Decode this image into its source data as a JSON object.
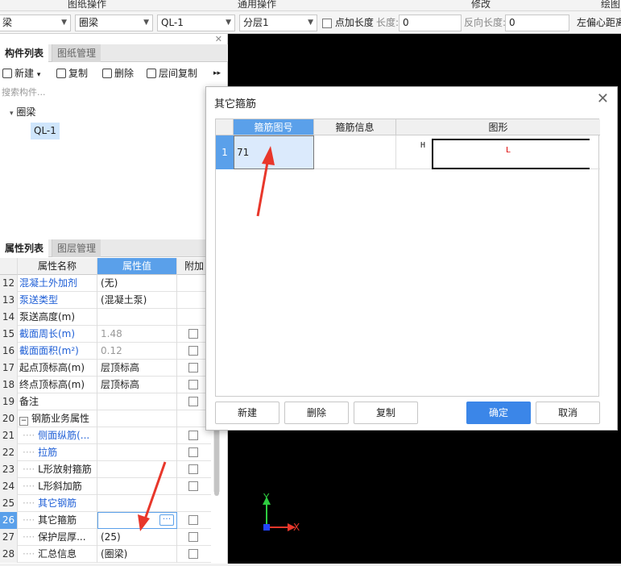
{
  "toolbar": {
    "items": [
      "图纸操作",
      "通用操作",
      "修改",
      "绘图"
    ]
  },
  "filters": {
    "combo1": "梁",
    "combo2": "圈梁",
    "combo3": "QL-1",
    "combo4": "分层1",
    "check_label": "点加长度",
    "length_label": "长度:",
    "length_value": "0",
    "reverse_label": "反向长度:",
    "reverse_value": "0",
    "offset_label": "左偏心距离"
  },
  "component_panel": {
    "tabs": [
      "构件列表",
      "图纸管理"
    ],
    "buttons": [
      "新建",
      "复制",
      "删除",
      "层间复制"
    ],
    "search_placeholder": "搜索构件...",
    "tree_parent": "圈梁",
    "tree_child": "QL-1"
  },
  "property_panel": {
    "tabs": [
      "属性列表",
      "图层管理"
    ],
    "headers": [
      "属性名称",
      "属性值",
      "附加"
    ],
    "rows": [
      {
        "num": "12",
        "name": "混凝土外加剂",
        "value": "(无)"
      },
      {
        "num": "13",
        "name": "泵送类型",
        "value": "(混凝土泵)"
      },
      {
        "num": "14",
        "name": "泵送高度(m)",
        "value": ""
      },
      {
        "num": "15",
        "name": "截面周长(m)",
        "value": "1.48"
      },
      {
        "num": "16",
        "name": "截面面积(m²)",
        "value": "0.12"
      },
      {
        "num": "17",
        "name": "起点顶标高(m)",
        "value": "层顶标高"
      },
      {
        "num": "18",
        "name": "终点顶标高(m)",
        "value": "层顶标高"
      },
      {
        "num": "19",
        "name": "备注",
        "value": ""
      },
      {
        "num": "20",
        "name": "钢筋业务属性",
        "value": ""
      },
      {
        "num": "21",
        "name": "侧面纵筋(...",
        "value": ""
      },
      {
        "num": "22",
        "name": "拉筋",
        "value": ""
      },
      {
        "num": "23",
        "name": "L形放射箍筋",
        "value": ""
      },
      {
        "num": "24",
        "name": "L形斜加筋",
        "value": ""
      },
      {
        "num": "25",
        "name": "其它钢筋",
        "value": ""
      },
      {
        "num": "26",
        "name": "其它箍筋",
        "value": ""
      },
      {
        "num": "27",
        "name": "保护层厚...",
        "value": "(25)"
      },
      {
        "num": "28",
        "name": "汇总信息",
        "value": "(圈梁)"
      }
    ],
    "ellipsis_button": "···",
    "collapse_icon": "minus-box-icon"
  },
  "dialog": {
    "title": "其它箍筋",
    "columns": [
      "箍筋图号",
      "箍筋信息",
      "图形"
    ],
    "row": {
      "num": "1",
      "code": "71",
      "info": "",
      "shape_h": "H",
      "shape_l": "L"
    },
    "buttons": [
      "新建",
      "删除",
      "复制",
      "确定",
      "取消"
    ]
  },
  "canvas": {
    "axis_y": "Y",
    "axis_x": "X"
  },
  "colors": {
    "accent": "#3b86e8",
    "blue_text": "#1f5fd6",
    "arrow_red": "#e8372b",
    "canvas": "#000000"
  }
}
